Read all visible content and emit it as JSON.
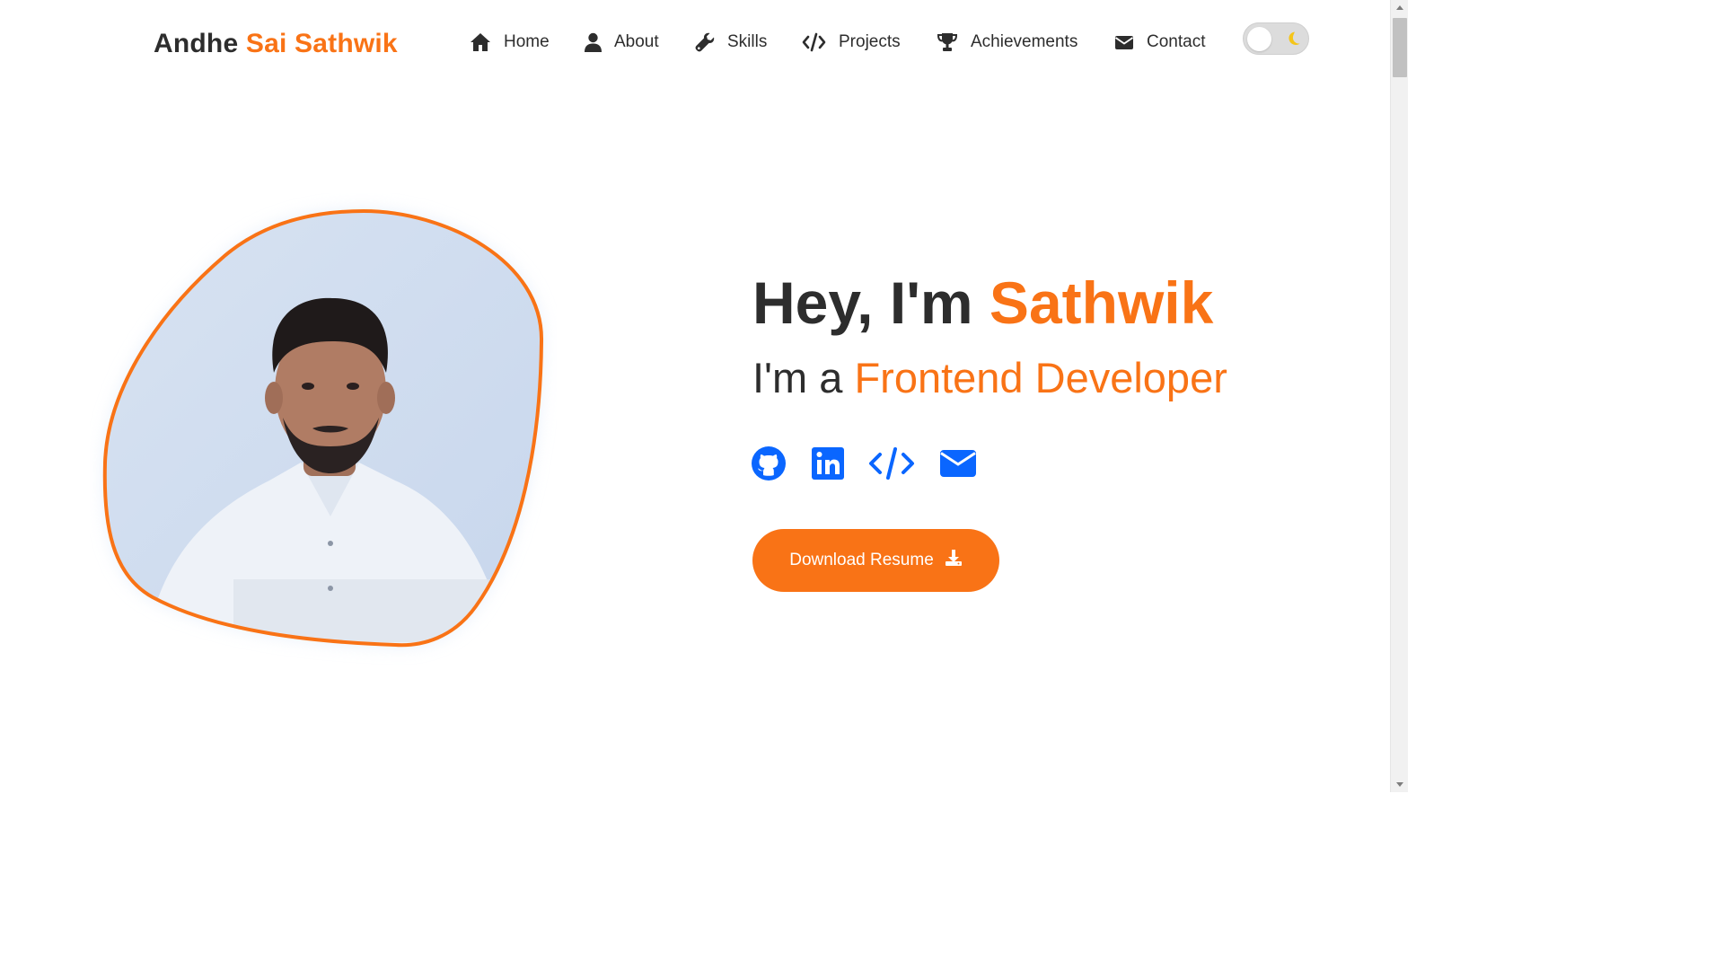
{
  "header": {
    "logo_first": "Andhe",
    "logo_rest": "Sai Sathwik",
    "nav": [
      {
        "label": "Home",
        "icon": "home-icon"
      },
      {
        "label": "About",
        "icon": "user-icon"
      },
      {
        "label": "Skills",
        "icon": "wrench-icon"
      },
      {
        "label": "Projects",
        "icon": "code-icon"
      },
      {
        "label": "Achievements",
        "icon": "trophy-icon"
      },
      {
        "label": "Contact",
        "icon": "envelope-icon"
      }
    ],
    "theme_toggle": {
      "state": "light",
      "icon": "moon-icon"
    }
  },
  "hero": {
    "greeting_prefix": "Hey, I'm",
    "greeting_name": "Sathwik",
    "role_prefix": "I'm a",
    "role_title": "Frontend Developer",
    "photo": {
      "icon": "profile-photo"
    },
    "socials": [
      {
        "name": "GitHub",
        "icon": "github-icon"
      },
      {
        "name": "LinkedIn",
        "icon": "linkedin-icon"
      },
      {
        "name": "Code",
        "icon": "code-icon"
      },
      {
        "name": "Email",
        "icon": "envelope-icon"
      }
    ],
    "resume_button": "Download Resume"
  },
  "colors": {
    "accent": "#f97316",
    "text": "#2d2d2d",
    "social_blue": "#0a66ff",
    "moon": "#f5c518"
  }
}
